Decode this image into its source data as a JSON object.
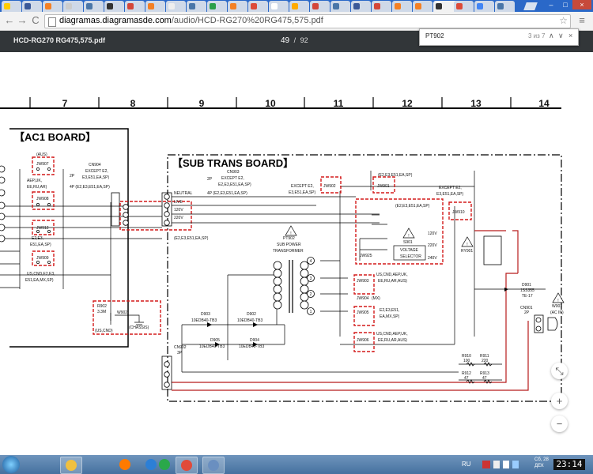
{
  "browser": {
    "tabs": [
      {
        "color": "#ffcc00"
      },
      {
        "color": "#3b5998"
      },
      {
        "color": "#f48024"
      },
      {
        "color": "#cccccc"
      },
      {
        "color": "#4a76a8"
      },
      {
        "color": "#333333"
      },
      {
        "color": "#d44638"
      },
      {
        "color": "#f48024"
      },
      {
        "color": "#eeeeee"
      },
      {
        "color": "#4a76a8"
      },
      {
        "color": "#2b9f4a"
      },
      {
        "color": "#f48024"
      },
      {
        "color": "#dd4b39"
      },
      {
        "color": "#ffffff"
      },
      {
        "color": "#ffaa00"
      },
      {
        "color": "#d44638"
      },
      {
        "color": "#4a76a8"
      },
      {
        "color": "#3b5998"
      },
      {
        "color": "#d44638"
      },
      {
        "color": "#f48024"
      },
      {
        "color": "#f48024"
      },
      {
        "color": "#333333"
      },
      {
        "color": "#dd4b39"
      },
      {
        "color": "#4285f4"
      },
      {
        "color": "#4a76a8"
      }
    ],
    "active_tab_close": "×",
    "url_host": "diagramas.diagramasde.com",
    "url_path": "/audio/HCD-RG270%20RG475,575.pdf",
    "nav_back": "←",
    "nav_forward": "→",
    "nav_reload": "C",
    "star": "☆",
    "menu": "≡",
    "win_min": "–",
    "win_max": "□",
    "win_close": "×"
  },
  "pdf": {
    "title": "HCD-RG270 RG475,575.pdf",
    "page_current": "49",
    "page_sep": "/",
    "page_total": "92",
    "find_query": "PT902",
    "find_count": "3 из 7",
    "find_prev": "∧",
    "find_next": "∨",
    "find_close": "×",
    "zoom_fit": "⤡",
    "zoom_in": "+",
    "zoom_out": "−"
  },
  "schematic": {
    "columns": [
      "7",
      "8",
      "9",
      "10",
      "11",
      "12",
      "13",
      "14"
    ],
    "ac1_board": "【AC1 BOARD】",
    "sub_trans_board": "【SUB TRANS BOARD】",
    "labels": {
      "aus": "(AUS)",
      "jw907": "JW907",
      "aep_uk": "AEP,UK,",
      "ee_ru_ar": "EE,RU,AR)",
      "jw908": "JW908",
      "jw912": "JW912",
      "e2_e3": "E2,E3,",
      "e51_ea_sp": "E51,EA,SP)",
      "jw909": "JW909",
      "us_cnd_e2": "US,CND,E2,E3,",
      "e51_ea_mx": "E51,EA,MX,SP)",
      "cn904": "CN904",
      "cn904_2p": "2P",
      "cn904_except": "EXCEPT E2,",
      "cn904_e3": "E3,E51,EA,SP)",
      "cn904_4p": "4P (E2,E3,E51,EA,SP)",
      "r902": "R902",
      "r902_val": "3.3M",
      "us_cnd": "(US,CND)",
      "w902": "W902",
      "chassis": "(CHASSIS)",
      "cn903": "CN903",
      "cn903_2p": "2P",
      "cn903_except": "EXCEPT E2,",
      "cn903_e3": "E2,E3,E51,EA,SP)",
      "cn903_4p": "4P (E2,E3,E51,EA,SP)",
      "neutral": "NEUTRAL",
      "live": "LIVE",
      "v120": "120V",
      "v220": "220V",
      "e2_list": "(E2,E3,E51,EA,SP)",
      "except_e2": "EXCEPT E2,",
      "e3_e51": "E3,E51,EA,SP)",
      "jw902": "JW902",
      "jw901": "JW901",
      "jw901_regions": "(E2,E3,E51,EA,SP)",
      "regions2": "(E2,E3,E51,EA,SP)",
      "except_e2b": "EXCEPT E2,",
      "e3b": "E3,E51,EA,SP)",
      "jw910": "JW910",
      "pt902": "PT902",
      "sub_power": "SUB POWER",
      "transformer": "TRANSFORMER",
      "s901": "S901",
      "voltage": "VOLTAGE",
      "selector": "SELECTOR",
      "sv120": "120V",
      "sv220": "220V",
      "sv240": "240V",
      "jw925": "JW925",
      "ry901": "RY901",
      "jw903": "JW903",
      "jw903_r1": "US,CND,AEP,UK,",
      "jw903_r2": "EE,RU,AR,AUS)",
      "jw904": "JW904",
      "mx": "(MX)",
      "jw905": "JW905",
      "jw905_r1": "E2,E3,E51,",
      "jw905_r2": "EA,MX,SP)",
      "jw906": "JW906",
      "jw906_r1": "US,CND,AEP,UK,",
      "jw906_r2": "EE,RU,AR,AUS)",
      "d903": "D903",
      "d903_t": "10EDB40-TB3",
      "d902": "D902",
      "d902_t": "10EDB40-TB3",
      "d905": "D905",
      "d905_t": "10EDB40-TB3",
      "d904": "D904",
      "d904_t": "10EDB40-TB3",
      "cn902": "CN902",
      "cn902_3p": "3P",
      "d901": "D901",
      "d901_t": "1SS355",
      "d901_t2": "TE-17",
      "cn901": "CN901",
      "cn901_2p": "2P",
      "w001": "W001",
      "ac_in": "(AC IN)",
      "r910": "R910",
      "r910_v": "100",
      "r911": "R911",
      "r911_v": "220",
      "r912": "R912",
      "r912_v": "47",
      "r913": "R913",
      "r913_v": "47",
      "pin1": "1",
      "pin2": "2",
      "pin3": "3",
      "pin4": "4"
    }
  },
  "taskbar": {
    "apps": [
      {
        "color": "#f0c040",
        "active": true
      },
      {
        "color": "#ff7a00",
        "active": false
      },
      {
        "color": "#2c7fd6",
        "active": false
      },
      {
        "color": "#2aa84a",
        "active": false
      },
      {
        "color": "#e04a3a",
        "active": true
      },
      {
        "color": "#6a8fc0",
        "active": true
      }
    ],
    "lang": "RU",
    "day": "Сб, 28",
    "month": "ДЕК",
    "time": "23:14"
  }
}
